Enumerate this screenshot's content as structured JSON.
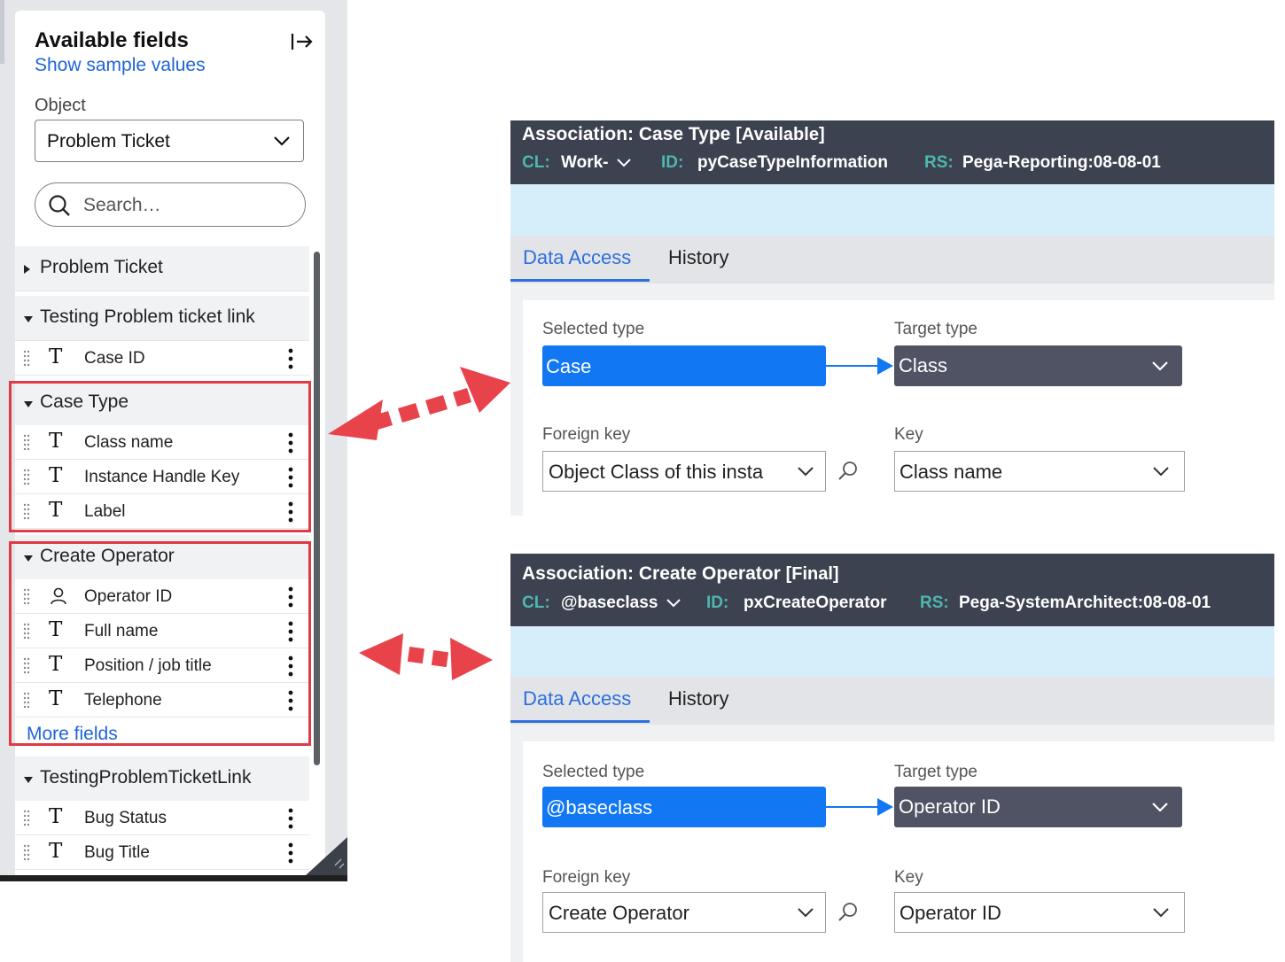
{
  "sidebar": {
    "title": "Available fields",
    "show_sample_values": "Show sample values",
    "object_label": "Object",
    "object_value": "Problem Ticket",
    "search_placeholder": "Search…",
    "groups": [
      {
        "label": "Problem Ticket",
        "expanded": false,
        "fields": []
      },
      {
        "label": "Testing Problem ticket link",
        "expanded": true,
        "fields": [
          {
            "type": "T",
            "label": "Case ID"
          }
        ]
      },
      {
        "label": "Case Type",
        "expanded": true,
        "fields": [
          {
            "type": "T",
            "label": "Class name"
          },
          {
            "type": "T",
            "label": "Instance Handle Key"
          },
          {
            "type": "T",
            "label": "Label"
          }
        ]
      },
      {
        "label": "Create Operator",
        "expanded": true,
        "fields": [
          {
            "type": "user",
            "label": "Operator ID"
          },
          {
            "type": "T",
            "label": "Full name"
          },
          {
            "type": "T",
            "label": "Position / job title"
          },
          {
            "type": "T",
            "label": "Telephone"
          }
        ],
        "more": "More fields"
      },
      {
        "label": "TestingProblemTicketLink",
        "expanded": true,
        "fields": [
          {
            "type": "T",
            "label": "Bug Status"
          },
          {
            "type": "T",
            "label": "Bug Title"
          }
        ]
      }
    ]
  },
  "associations": [
    {
      "title": "Association: Case Type",
      "status": "[Available]",
      "cl_key": "CL:",
      "cl_value": "Work-",
      "id_key": "ID:",
      "id_value": "pyCaseTypeInformation",
      "rs_key": "RS:",
      "rs_value": "Pega-Reporting:08-08-01",
      "tabs": [
        "Data Access",
        "History"
      ],
      "selected_type_label": "Selected type",
      "selected_type": "Case",
      "target_type_label": "Target type",
      "target_type": "Class",
      "foreign_key_label": "Foreign key",
      "foreign_key": "Object Class of this insta",
      "key_label": "Key",
      "key": "Class name"
    },
    {
      "title": "Association: Create Operator",
      "status": "[Final]",
      "cl_key": "CL:",
      "cl_value": "@baseclass",
      "id_key": "ID:",
      "id_value": "pxCreateOperator",
      "rs_key": "RS:",
      "rs_value": "Pega-SystemArchitect:08-08-01",
      "tabs": [
        "Data Access",
        "History"
      ],
      "selected_type_label": "Selected type",
      "selected_type": "@baseclass",
      "target_type_label": "Target type",
      "target_type": "Operator ID",
      "foreign_key_label": "Foreign key",
      "foreign_key": "Create Operator",
      "key_label": "Key",
      "key": "Operator ID"
    }
  ],
  "colors": {
    "link": "#1f64d8",
    "highlight": "#e03a45",
    "header_dark": "#3d4251",
    "meta_key": "#4cb8b0",
    "primary_blue": "#1177f2",
    "target_dark": "#4f5364"
  },
  "icons": [
    "collapse-panel-icon",
    "chevron-down-icon",
    "search-icon",
    "caret-icon",
    "drag-handle-icon",
    "text-type-icon",
    "user-icon",
    "kebab-menu-icon",
    "magnifier-icon"
  ]
}
